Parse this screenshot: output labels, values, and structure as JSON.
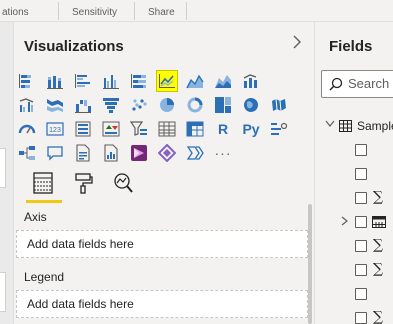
{
  "ribbon": {
    "groups": [
      {
        "label": "ations"
      },
      {
        "label": "Sensitivity"
      },
      {
        "label": "Share"
      }
    ]
  },
  "visualizations": {
    "title": "Visualizations",
    "collapse_icon": "chevron-right-icon",
    "selected": "line-chart",
    "icons": [
      "stacked-bar-chart",
      "stacked-column-chart",
      "clustered-bar-chart",
      "clustered-column-chart",
      "100-stacked-bar-chart",
      "line-chart",
      "area-chart",
      "stacked-area-chart",
      "line-and-stacked-column-chart",
      "line-and-clustered-column-chart",
      "ribbon-chart",
      "waterfall-chart",
      "funnel-chart",
      "scatter-chart",
      "pie-chart",
      "donut-chart",
      "treemap",
      "map",
      "filled-map",
      "gauge",
      "card",
      "multi-row-card",
      "kpi",
      "slicer",
      "table",
      "matrix",
      "r-script-visual",
      "python-visual",
      "key-influencers",
      "decomposition-tree",
      "qa-visual",
      "smart-narrative",
      "paginated-report",
      "power-apps",
      "power-automate",
      "more"
    ],
    "r_glyph": "R",
    "py_glyph": "Py",
    "more_glyph": "···",
    "subtabs": [
      "fields-tab",
      "format-tab",
      "analytics-tab"
    ],
    "wells": [
      {
        "label": "Axis",
        "placeholder": "Add data fields here"
      },
      {
        "label": "Legend",
        "placeholder": "Add data fields here"
      }
    ]
  },
  "fields": {
    "title": "Fields",
    "search_placeholder": "Search",
    "table_name": "Sample",
    "sigma": "∑"
  },
  "colors": {
    "selected_highlight": "#ffff00",
    "accent_underline": "#f2c811",
    "icon_blue": "#2c6fb7",
    "pane_bg": "#f3f2f1"
  }
}
